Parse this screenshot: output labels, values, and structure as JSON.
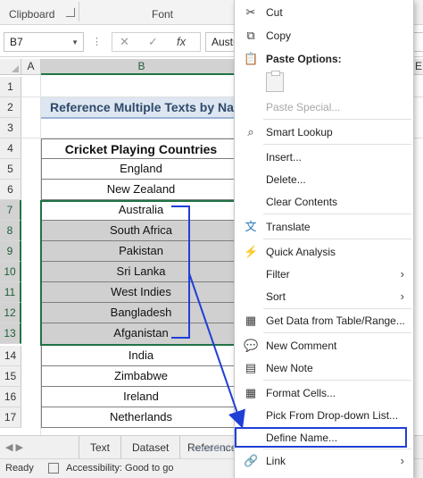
{
  "ribbon": {
    "clipboard_label": "Clipboard",
    "font_label": "Font"
  },
  "formula_bar": {
    "name_box": "B7",
    "cancel_glyph": "✕",
    "enter_glyph": "✓",
    "fx_glyph": "fx",
    "content": "Austr"
  },
  "grid": {
    "columns": [
      "A",
      "B",
      "E"
    ],
    "rows": [
      "1",
      "2",
      "3",
      "4",
      "5",
      "6",
      "7",
      "8",
      "9",
      "10",
      "11",
      "12",
      "13",
      "14",
      "15",
      "16",
      "17"
    ],
    "title": "Reference Multiple Texts by Nam",
    "table_header": "Cricket Playing Countries",
    "countries": [
      "England",
      "New Zealand",
      "Australia",
      "South Africa",
      "Pakistan",
      "Sri Lanka",
      "West Indies",
      "Bangladesh",
      "Afganistan",
      "India",
      "Zimbabwe",
      "Ireland",
      "Netherlands"
    ]
  },
  "sheet_tabs": [
    "Text",
    "Dataset",
    "Reference"
  ],
  "watermark": "exceldemy",
  "status": {
    "ready": "Ready",
    "accessibility": "Accessibility: Good to go"
  },
  "context_menu": {
    "cut": "Cut",
    "copy": "Copy",
    "paste_options": "Paste Options:",
    "paste_special": "Paste Special...",
    "smart_lookup": "Smart Lookup",
    "insert": "Insert...",
    "delete": "Delete...",
    "clear_contents": "Clear Contents",
    "translate": "Translate",
    "quick_analysis": "Quick Analysis",
    "filter": "Filter",
    "sort": "Sort",
    "get_data": "Get Data from Table/Range...",
    "new_comment": "New Comment",
    "new_note": "New Note",
    "format_cells": "Format Cells...",
    "pick_dropdown": "Pick From Drop-down List...",
    "define_name": "Define Name...",
    "link": "Link"
  },
  "colors": {
    "selection_green": "#217346",
    "arrow_blue": "#1f3fd6",
    "selected_fill": "#d0d0d0",
    "title_fill": "#dde6f1"
  }
}
